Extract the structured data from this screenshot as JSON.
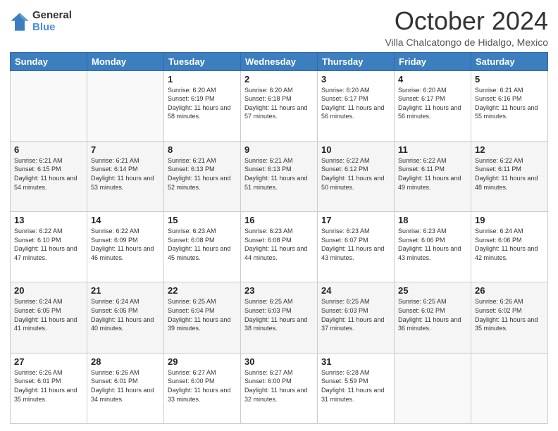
{
  "logo": {
    "general": "General",
    "blue": "Blue"
  },
  "header": {
    "month": "October 2024",
    "subtitle": "Villa Chalcatongo de Hidalgo, Mexico"
  },
  "days_of_week": [
    "Sunday",
    "Monday",
    "Tuesday",
    "Wednesday",
    "Thursday",
    "Friday",
    "Saturday"
  ],
  "weeks": [
    [
      {
        "day": "",
        "sunrise": "",
        "sunset": "",
        "daylight": "",
        "empty": true
      },
      {
        "day": "",
        "sunrise": "",
        "sunset": "",
        "daylight": "",
        "empty": true
      },
      {
        "day": "1",
        "sunrise": "Sunrise: 6:20 AM",
        "sunset": "Sunset: 6:19 PM",
        "daylight": "Daylight: 11 hours and 58 minutes."
      },
      {
        "day": "2",
        "sunrise": "Sunrise: 6:20 AM",
        "sunset": "Sunset: 6:18 PM",
        "daylight": "Daylight: 11 hours and 57 minutes."
      },
      {
        "day": "3",
        "sunrise": "Sunrise: 6:20 AM",
        "sunset": "Sunset: 6:17 PM",
        "daylight": "Daylight: 11 hours and 56 minutes."
      },
      {
        "day": "4",
        "sunrise": "Sunrise: 6:20 AM",
        "sunset": "Sunset: 6:17 PM",
        "daylight": "Daylight: 11 hours and 56 minutes."
      },
      {
        "day": "5",
        "sunrise": "Sunrise: 6:21 AM",
        "sunset": "Sunset: 6:16 PM",
        "daylight": "Daylight: 11 hours and 55 minutes."
      }
    ],
    [
      {
        "day": "6",
        "sunrise": "Sunrise: 6:21 AM",
        "sunset": "Sunset: 6:15 PM",
        "daylight": "Daylight: 11 hours and 54 minutes."
      },
      {
        "day": "7",
        "sunrise": "Sunrise: 6:21 AM",
        "sunset": "Sunset: 6:14 PM",
        "daylight": "Daylight: 11 hours and 53 minutes."
      },
      {
        "day": "8",
        "sunrise": "Sunrise: 6:21 AM",
        "sunset": "Sunset: 6:13 PM",
        "daylight": "Daylight: 11 hours and 52 minutes."
      },
      {
        "day": "9",
        "sunrise": "Sunrise: 6:21 AM",
        "sunset": "Sunset: 6:13 PM",
        "daylight": "Daylight: 11 hours and 51 minutes."
      },
      {
        "day": "10",
        "sunrise": "Sunrise: 6:22 AM",
        "sunset": "Sunset: 6:12 PM",
        "daylight": "Daylight: 11 hours and 50 minutes."
      },
      {
        "day": "11",
        "sunrise": "Sunrise: 6:22 AM",
        "sunset": "Sunset: 6:11 PM",
        "daylight": "Daylight: 11 hours and 49 minutes."
      },
      {
        "day": "12",
        "sunrise": "Sunrise: 6:22 AM",
        "sunset": "Sunset: 6:11 PM",
        "daylight": "Daylight: 11 hours and 48 minutes."
      }
    ],
    [
      {
        "day": "13",
        "sunrise": "Sunrise: 6:22 AM",
        "sunset": "Sunset: 6:10 PM",
        "daylight": "Daylight: 11 hours and 47 minutes."
      },
      {
        "day": "14",
        "sunrise": "Sunrise: 6:22 AM",
        "sunset": "Sunset: 6:09 PM",
        "daylight": "Daylight: 11 hours and 46 minutes."
      },
      {
        "day": "15",
        "sunrise": "Sunrise: 6:23 AM",
        "sunset": "Sunset: 6:08 PM",
        "daylight": "Daylight: 11 hours and 45 minutes."
      },
      {
        "day": "16",
        "sunrise": "Sunrise: 6:23 AM",
        "sunset": "Sunset: 6:08 PM",
        "daylight": "Daylight: 11 hours and 44 minutes."
      },
      {
        "day": "17",
        "sunrise": "Sunrise: 6:23 AM",
        "sunset": "Sunset: 6:07 PM",
        "daylight": "Daylight: 11 hours and 43 minutes."
      },
      {
        "day": "18",
        "sunrise": "Sunrise: 6:23 AM",
        "sunset": "Sunset: 6:06 PM",
        "daylight": "Daylight: 11 hours and 43 minutes."
      },
      {
        "day": "19",
        "sunrise": "Sunrise: 6:24 AM",
        "sunset": "Sunset: 6:06 PM",
        "daylight": "Daylight: 11 hours and 42 minutes."
      }
    ],
    [
      {
        "day": "20",
        "sunrise": "Sunrise: 6:24 AM",
        "sunset": "Sunset: 6:05 PM",
        "daylight": "Daylight: 11 hours and 41 minutes."
      },
      {
        "day": "21",
        "sunrise": "Sunrise: 6:24 AM",
        "sunset": "Sunset: 6:05 PM",
        "daylight": "Daylight: 11 hours and 40 minutes."
      },
      {
        "day": "22",
        "sunrise": "Sunrise: 6:25 AM",
        "sunset": "Sunset: 6:04 PM",
        "daylight": "Daylight: 11 hours and 39 minutes."
      },
      {
        "day": "23",
        "sunrise": "Sunrise: 6:25 AM",
        "sunset": "Sunset: 6:03 PM",
        "daylight": "Daylight: 11 hours and 38 minutes."
      },
      {
        "day": "24",
        "sunrise": "Sunrise: 6:25 AM",
        "sunset": "Sunset: 6:03 PM",
        "daylight": "Daylight: 11 hours and 37 minutes."
      },
      {
        "day": "25",
        "sunrise": "Sunrise: 6:25 AM",
        "sunset": "Sunset: 6:02 PM",
        "daylight": "Daylight: 11 hours and 36 minutes."
      },
      {
        "day": "26",
        "sunrise": "Sunrise: 6:26 AM",
        "sunset": "Sunset: 6:02 PM",
        "daylight": "Daylight: 11 hours and 35 minutes."
      }
    ],
    [
      {
        "day": "27",
        "sunrise": "Sunrise: 6:26 AM",
        "sunset": "Sunset: 6:01 PM",
        "daylight": "Daylight: 11 hours and 35 minutes."
      },
      {
        "day": "28",
        "sunrise": "Sunrise: 6:26 AM",
        "sunset": "Sunset: 6:01 PM",
        "daylight": "Daylight: 11 hours and 34 minutes."
      },
      {
        "day": "29",
        "sunrise": "Sunrise: 6:27 AM",
        "sunset": "Sunset: 6:00 PM",
        "daylight": "Daylight: 11 hours and 33 minutes."
      },
      {
        "day": "30",
        "sunrise": "Sunrise: 6:27 AM",
        "sunset": "Sunset: 6:00 PM",
        "daylight": "Daylight: 11 hours and 32 minutes."
      },
      {
        "day": "31",
        "sunrise": "Sunrise: 6:28 AM",
        "sunset": "Sunset: 5:59 PM",
        "daylight": "Daylight: 11 hours and 31 minutes."
      },
      {
        "day": "",
        "sunrise": "",
        "sunset": "",
        "daylight": "",
        "empty": true
      },
      {
        "day": "",
        "sunrise": "",
        "sunset": "",
        "daylight": "",
        "empty": true
      }
    ]
  ]
}
